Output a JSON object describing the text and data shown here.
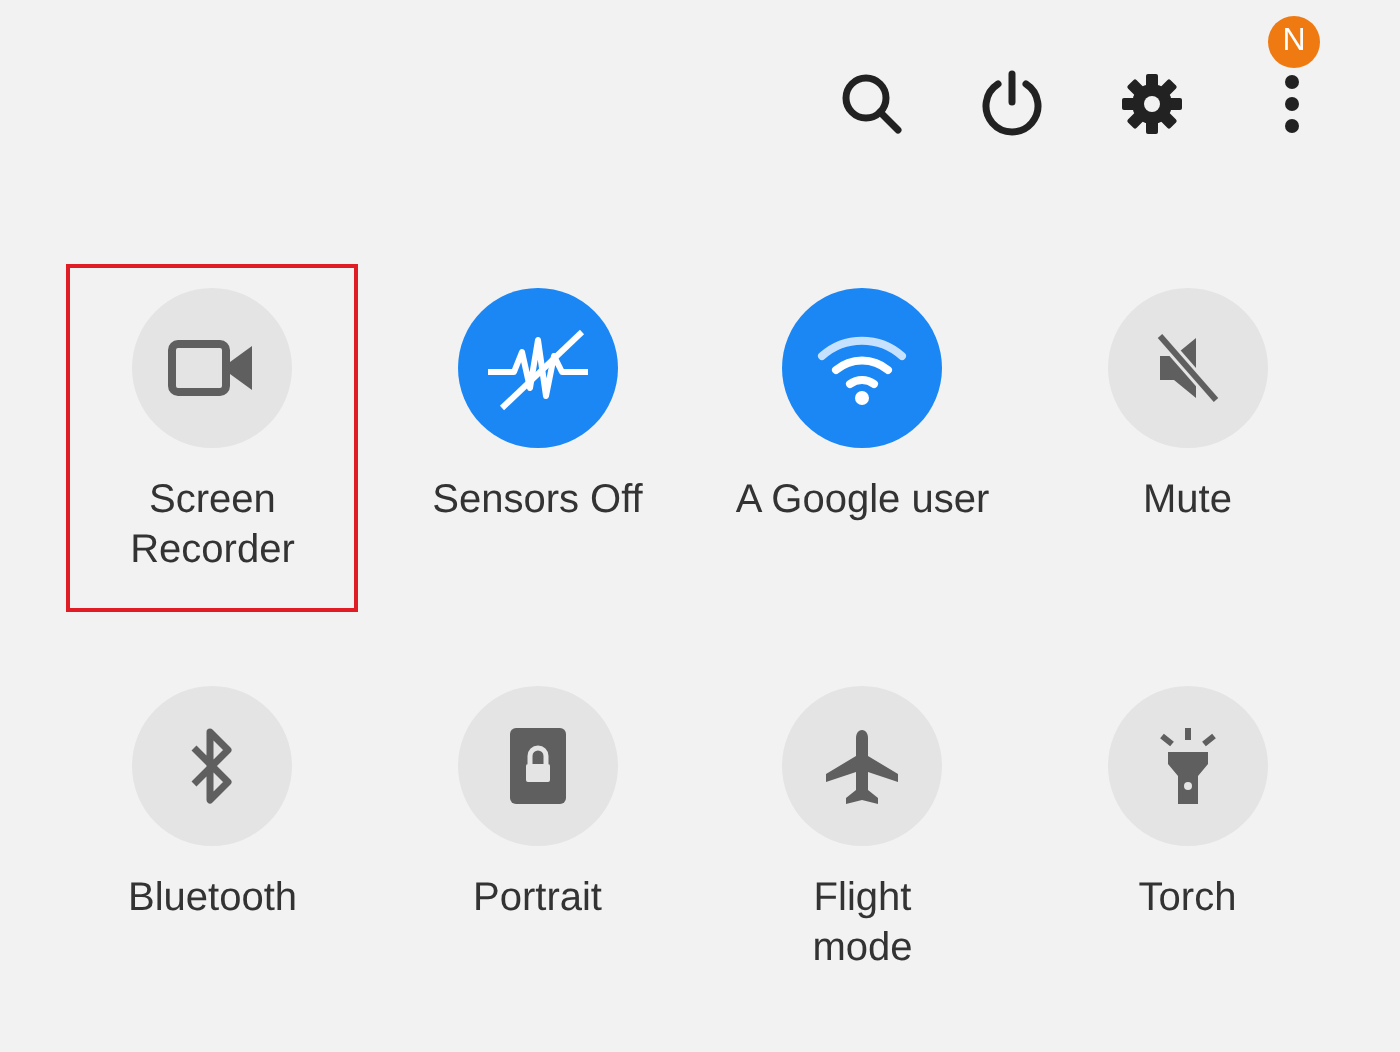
{
  "toolbar": {
    "profile_badge": "N"
  },
  "tiles": [
    {
      "kind": "video",
      "label": "Screen\nRecorder",
      "on": false,
      "highlighted": true
    },
    {
      "kind": "sensors",
      "label": "Sensors Off",
      "on": true,
      "highlighted": false
    },
    {
      "kind": "wifi",
      "label": "A Google user",
      "on": true,
      "highlighted": false
    },
    {
      "kind": "mute",
      "label": "Mute",
      "on": false,
      "highlighted": false
    },
    {
      "kind": "bluetooth",
      "label": "Bluetooth",
      "on": false,
      "highlighted": false
    },
    {
      "kind": "portrait",
      "label": "Portrait",
      "on": false,
      "highlighted": false
    },
    {
      "kind": "flight",
      "label": "Flight\nmode",
      "on": false,
      "highlighted": false
    },
    {
      "kind": "torch",
      "label": "Torch",
      "on": false,
      "highlighted": false
    }
  ]
}
